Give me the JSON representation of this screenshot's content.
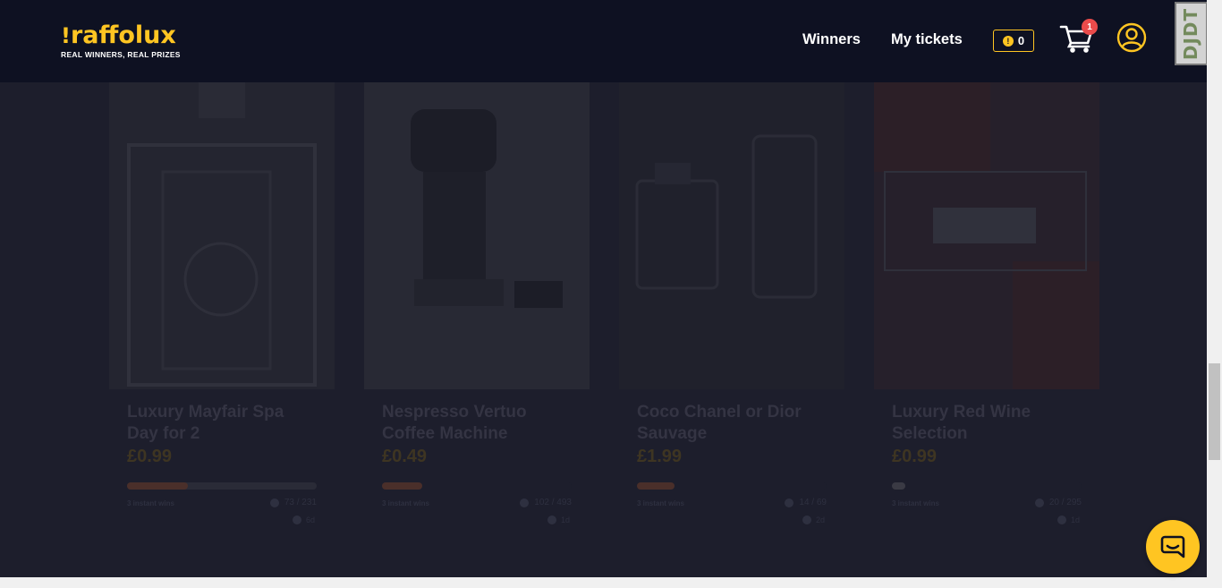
{
  "header": {
    "logo_word": "raffolux",
    "logo_tagline": "REAL WINNERS, REAL PRIZES",
    "nav": {
      "winners": "Winners",
      "my_tickets": "My tickets"
    },
    "coins_value": "0",
    "cart_count": "1",
    "devtools_label": "DJDT"
  },
  "colors": {
    "brand_yellow": "#ffc522",
    "header_bg": "#0e1122",
    "overlay_bg": "#1d1e2c",
    "badge_red": "#e94b4b"
  },
  "cards": [
    {
      "title": "Luxury Mayfair Spa Day for 2",
      "price": "£0.99",
      "instant": "3 instant wins",
      "tickets": "73 / 231",
      "timer": "6d",
      "progress_fraction": 0.32
    },
    {
      "title": "Nespresso Vertuo Coffee Machine",
      "price": "£0.49",
      "instant": "3 instant wins",
      "tickets": "102 / 493",
      "timer": "1d",
      "progress_fraction": 0.21
    },
    {
      "title": "Coco Chanel or Dior Sauvage",
      "price": "£1.99",
      "instant": "3 instant wins",
      "tickets": "14 / 69",
      "timer": "2d",
      "progress_fraction": 0.2
    },
    {
      "title": "Luxury Red Wine Selection",
      "price": "£0.99",
      "instant": "3 instant wins",
      "tickets": "20 / 295",
      "timer": "1d",
      "progress_fraction": 0.07
    }
  ],
  "icons": {
    "cart": "shopping-cart-icon",
    "account": "user-circle-icon",
    "coin": "coin-icon",
    "chat": "chat-bubble-icon"
  }
}
